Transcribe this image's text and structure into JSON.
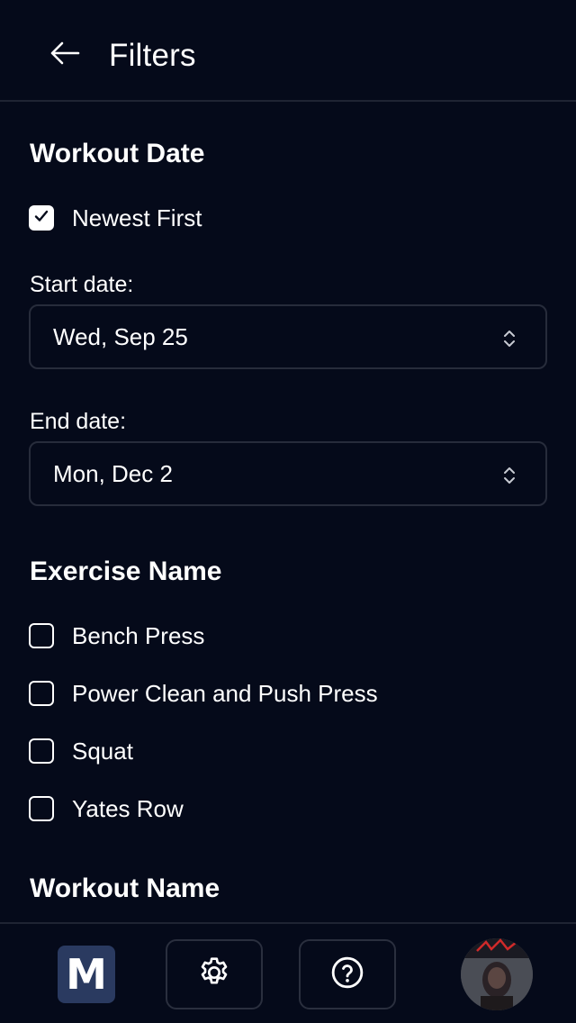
{
  "header": {
    "title": "Filters",
    "back_icon": "arrow-left-icon"
  },
  "workout_date": {
    "heading": "Workout Date",
    "newest_first": {
      "label": "Newest First",
      "checked": true
    },
    "start": {
      "label": "Start date:",
      "value": "Wed, Sep 25"
    },
    "end": {
      "label": "End date:",
      "value": "Mon, Dec 2"
    }
  },
  "exercise_name": {
    "heading": "Exercise Name",
    "options": [
      {
        "label": "Bench Press",
        "checked": false
      },
      {
        "label": "Power Clean and Push Press",
        "checked": false
      },
      {
        "label": "Squat",
        "checked": false
      },
      {
        "label": "Yates Row",
        "checked": false
      }
    ]
  },
  "workout_name": {
    "heading": "Workout Name"
  },
  "bottom_nav": {
    "logo_letter": "M",
    "settings_icon": "gear-icon",
    "help_icon": "question-circle-icon",
    "avatar": "user-avatar"
  },
  "colors": {
    "background": "#050a1a",
    "border": "#272c3b",
    "text": "#ffffff",
    "logo_tile": "#2a3a60"
  }
}
